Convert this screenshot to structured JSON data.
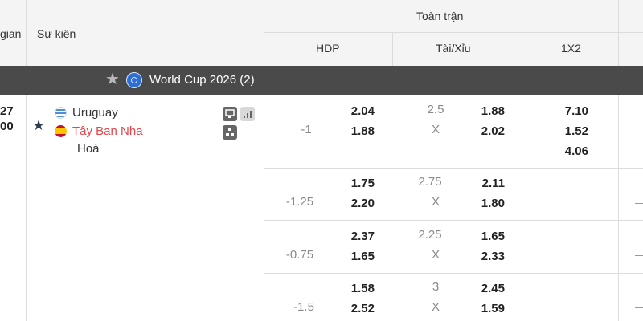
{
  "header": {
    "time_col": "gian",
    "event_col": "Sự kiện",
    "full_match": "Toàn trận",
    "hdp": "HDP",
    "ou": "Tài/Xỉu",
    "x12": "1X2"
  },
  "league": {
    "name": "World Cup 2026 (2)"
  },
  "match": {
    "time_line1": "27",
    "time_line2": "00",
    "home": "Uruguay",
    "away": "Tây Ban Nha",
    "draw": "Hoà"
  },
  "rows": [
    {
      "hdp_line": "-1",
      "hdp_home": "2.04",
      "hdp_away": "1.88",
      "ou_line": "2.5",
      "ou_x": "X",
      "ou_over": "1.88",
      "ou_under": "2.02",
      "x1": "7.10",
      "x2": "1.52",
      "xd": "4.06"
    },
    {
      "hdp_line": "-1.25",
      "hdp_home": "1.75",
      "hdp_away": "2.20",
      "ou_line": "2.75",
      "ou_x": "X",
      "ou_over": "2.11",
      "ou_under": "1.80"
    },
    {
      "hdp_line": "-0.75",
      "hdp_home": "2.37",
      "hdp_away": "1.65",
      "ou_line": "2.25",
      "ou_x": "X",
      "ou_over": "1.65",
      "ou_under": "2.33"
    },
    {
      "hdp_line": "-1.5",
      "hdp_home": "1.58",
      "hdp_away": "2.52",
      "ou_line": "3",
      "ou_x": "X",
      "ou_over": "2.45",
      "ou_under": "1.59"
    }
  ],
  "colors": {
    "league_bar": "#4a4a4a",
    "away_team": "#e0474c",
    "header_bg": "#f4f4f4"
  }
}
